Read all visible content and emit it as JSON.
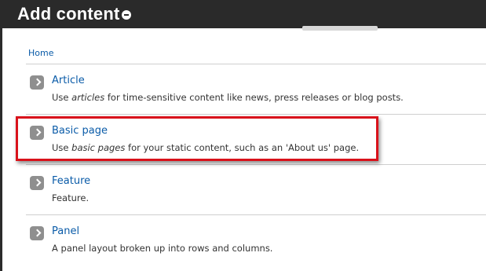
{
  "header": {
    "title": "Add content"
  },
  "breadcrumb": {
    "home": "Home"
  },
  "items": [
    {
      "label": "Article",
      "desc_pre": "Use ",
      "desc_em": "articles",
      "desc_post": " for time-sensitive content like news, press releases or blog posts."
    },
    {
      "label": "Basic page",
      "desc_pre": "Use ",
      "desc_em": "basic pages",
      "desc_post": " for your static content, such as an 'About us' page."
    },
    {
      "label": "Feature",
      "desc_pre": "Feature.",
      "desc_em": "",
      "desc_post": ""
    },
    {
      "label": "Panel",
      "desc_pre": "A panel layout broken up into rows and columns.",
      "desc_em": "",
      "desc_post": ""
    }
  ],
  "colors": {
    "link": "#0a5ba8",
    "highlight": "#d9121b",
    "header_bg": "#2a2a2a"
  }
}
